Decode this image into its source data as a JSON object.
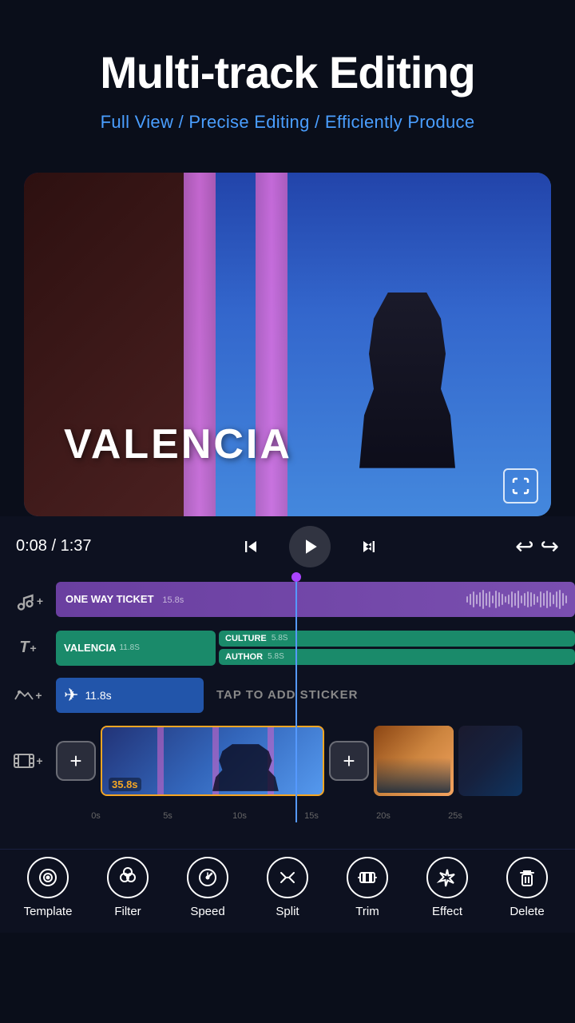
{
  "header": {
    "main_title": "Multi-track Editing",
    "subtitle": "Full View / Precise Editing / Efficiently Produce"
  },
  "video_preview": {
    "title_overlay": "VALENCIA",
    "fullscreen_label": "fullscreen"
  },
  "timeline": {
    "time_current": "0:08",
    "time_total": "1:37",
    "time_display": "0:08 / 1:37",
    "audio_track": {
      "label": "ONE WAY TICKET",
      "duration": "15.8s"
    },
    "text_tracks": [
      {
        "label": "VALENCIA",
        "duration": "11.8s"
      },
      {
        "label": "CULTURE",
        "duration": "5.8s"
      },
      {
        "label": "AUTHOR",
        "duration": "5.8s"
      }
    ],
    "sticker_track": {
      "duration": "11.8s",
      "tap_label": "TAP TO ADD STICKER"
    },
    "video_track": {
      "duration": "35.8s",
      "label": "35.8s"
    },
    "ruler": {
      "marks": [
        "0s",
        "5s",
        "10s",
        "15s",
        "20s",
        "25s"
      ]
    }
  },
  "toolbar": {
    "items": [
      {
        "id": "template",
        "label": "Template",
        "icon": "⊙"
      },
      {
        "id": "filter",
        "label": "Filter",
        "icon": "⬡"
      },
      {
        "id": "speed",
        "label": "Speed",
        "icon": "◎"
      },
      {
        "id": "split",
        "label": "Split",
        "icon": "✂"
      },
      {
        "id": "trim",
        "label": "Trim",
        "icon": "⟨⟩"
      },
      {
        "id": "effect",
        "label": "Effect",
        "icon": "✦"
      },
      {
        "id": "delete",
        "label": "Delete",
        "icon": "🗑"
      }
    ]
  }
}
